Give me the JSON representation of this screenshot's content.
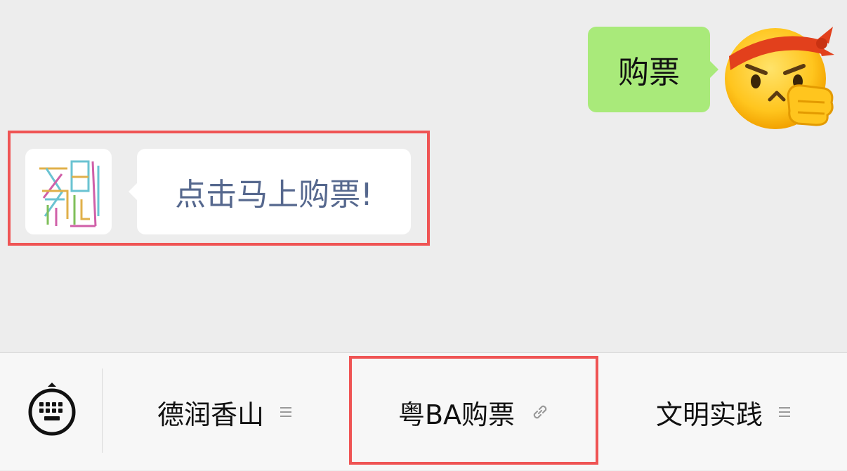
{
  "chat": {
    "outgoing_message": "购票",
    "incoming_message": "点击马上购票!"
  },
  "menu": {
    "items": [
      {
        "label": "德润香山",
        "icon": "list-icon"
      },
      {
        "label": "粤BA购票",
        "icon": "link-icon"
      },
      {
        "label": "文明实践",
        "icon": "list-icon"
      }
    ]
  },
  "colors": {
    "background": "#ededed",
    "outgoing_bubble": "#a9ea7a",
    "incoming_text": "#56688e",
    "highlight": "#ef5454",
    "menu_bar": "#f7f7f7"
  }
}
